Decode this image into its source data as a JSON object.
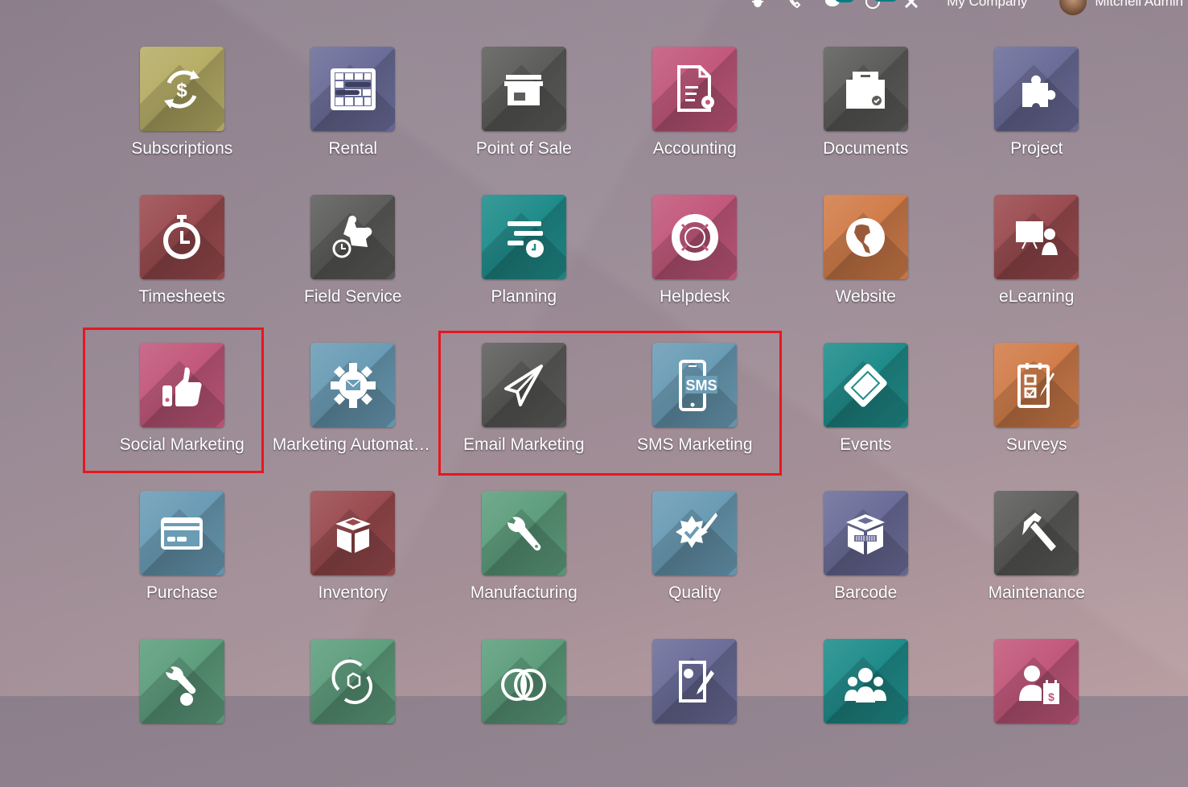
{
  "navbar": {
    "icons": [
      "bug-icon",
      "phone-icon",
      "chat-icon",
      "activity-clock-icon",
      "tools-icon"
    ],
    "company": "My Company",
    "user": "Mitchell Admin"
  },
  "apps": [
    {
      "label": "Subscriptions",
      "icon": "subscriptions-icon",
      "color": "#b6ad66"
    },
    {
      "label": "Rental",
      "icon": "rental-icon",
      "color": "#6b6d99"
    },
    {
      "label": "Point of Sale",
      "icon": "store-icon",
      "color": "#5d5d5b"
    },
    {
      "label": "Accounting",
      "icon": "accounting-icon",
      "color": "#c2587b"
    },
    {
      "label": "Documents",
      "icon": "documents-icon",
      "color": "#5d5d5b"
    },
    {
      "label": "Project",
      "icon": "puzzle-icon",
      "color": "#6b6d99"
    },
    {
      "label": "Timesheets",
      "icon": "stopwatch-icon",
      "color": "#9a4b4f"
    },
    {
      "label": "Field Service",
      "icon": "field-service-icon",
      "color": "#5d5d5b"
    },
    {
      "label": "Planning",
      "icon": "planning-icon",
      "color": "#1f8c8a"
    },
    {
      "label": "Helpdesk",
      "icon": "lifebuoy-icon",
      "color": "#c2587b"
    },
    {
      "label": "Website",
      "icon": "globe-icon",
      "color": "#d17d4a"
    },
    {
      "label": "eLearning",
      "icon": "elearning-icon",
      "color": "#9a4b4f"
    },
    {
      "label": "Social Marketing",
      "icon": "thumbs-up-icon",
      "color": "#c2587b"
    },
    {
      "label": "Marketing Automation",
      "icon": "gear-mail-icon",
      "color": "#6a9cb5"
    },
    {
      "label": "Email Marketing",
      "icon": "paper-plane-icon",
      "color": "#5d5d5b"
    },
    {
      "label": "SMS Marketing",
      "icon": "sms-phone-icon",
      "color": "#6a9cb5"
    },
    {
      "label": "Events",
      "icon": "ticket-icon",
      "color": "#1f8c8a"
    },
    {
      "label": "Surveys",
      "icon": "survey-icon",
      "color": "#d17d4a"
    },
    {
      "label": "Purchase",
      "icon": "credit-card-icon",
      "color": "#6a9cb5"
    },
    {
      "label": "Inventory",
      "icon": "box-icon",
      "color": "#9a4b4f"
    },
    {
      "label": "Manufacturing",
      "icon": "wrench-icon",
      "color": "#5e9e7d"
    },
    {
      "label": "Quality",
      "icon": "quality-badge-icon",
      "color": "#6a9cb5"
    },
    {
      "label": "Barcode",
      "icon": "barcode-box-icon",
      "color": "#6b6d99"
    },
    {
      "label": "Maintenance",
      "icon": "hammer-icon",
      "color": "#5d5d5b"
    },
    {
      "label": "",
      "icon": "repair-icon",
      "color": "#5e9e7d"
    },
    {
      "label": "",
      "icon": "recycle-box-icon",
      "color": "#5e9e7d"
    },
    {
      "label": "",
      "icon": "venn-icon",
      "color": "#5e9e7d"
    },
    {
      "label": "",
      "icon": "sign-icon",
      "color": "#6b6d99"
    },
    {
      "label": "",
      "icon": "team-icon",
      "color": "#1f8c8a"
    },
    {
      "label": "",
      "icon": "payroll-icon",
      "color": "#c2587b"
    }
  ],
  "highlight_color": "#e8161f"
}
